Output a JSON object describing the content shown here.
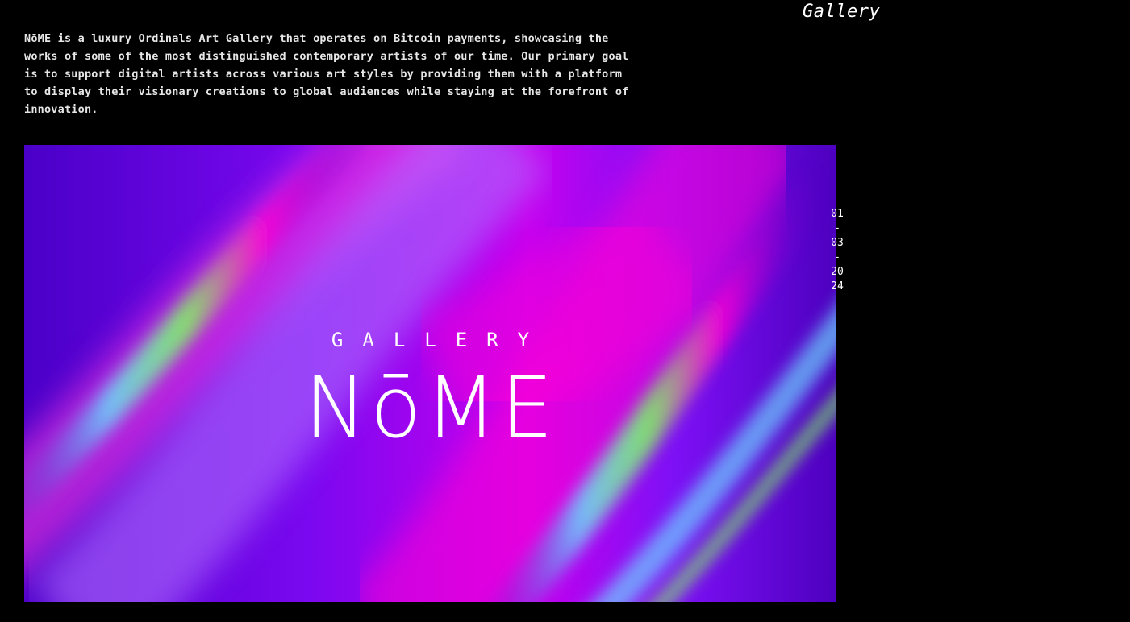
{
  "section": {
    "title": "Gallery"
  },
  "intro": {
    "text": "NōME is a luxury Ordinals Art Gallery that operates on Bitcoin payments, showcasing the works of some of the most distinguished contemporary artists of our time. Our primary goal is to support digital artists across various art styles by providing them with a platform to display their visionary creations to global audiences while staying at the forefront of innovation."
  },
  "hero": {
    "kicker": "GALLERY",
    "brand": "NōME",
    "colors": {
      "base": "#4a00c8",
      "magenta": "#ff00d4",
      "violet": "#8a10ff",
      "cyan": "#6ad8ff",
      "green": "#7cff5a"
    }
  },
  "date": {
    "parts": [
      "01",
      "-",
      "03",
      "-",
      "20",
      "24"
    ]
  }
}
